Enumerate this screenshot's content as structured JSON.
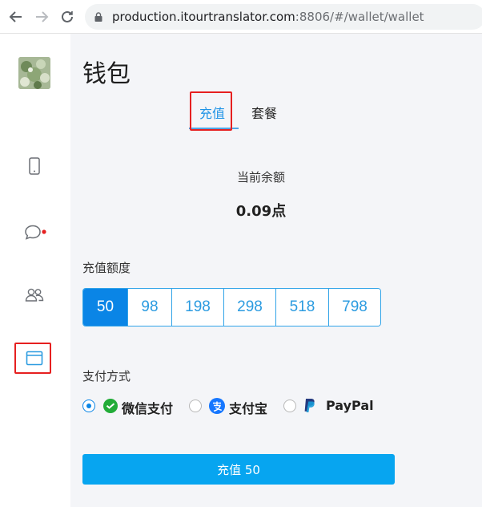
{
  "browser": {
    "url_host": "production.itourtranslator.com",
    "url_rest": ":8806/#/wallet/wallet",
    "back_icon": "arrow-left-icon",
    "forward_icon": "arrow-right-icon",
    "reload_icon": "reload-icon",
    "lock_icon": "lock-icon"
  },
  "sidebar": {
    "items": [
      {
        "name": "phone",
        "icon": "phone-icon"
      },
      {
        "name": "chat",
        "icon": "chat-icon",
        "has_badge": true
      },
      {
        "name": "contacts",
        "icon": "contacts-icon"
      },
      {
        "name": "wallet",
        "icon": "wallet-icon",
        "active": true
      }
    ],
    "accent": "#2b9be0",
    "badge_color": "#e62020"
  },
  "page": {
    "title": "钱包",
    "tabs": [
      {
        "label": "充值",
        "active": true
      },
      {
        "label": "套餐",
        "active": false
      }
    ],
    "balance_label": "当前余额",
    "balance_value": "0.09点",
    "amount_label": "充值额度",
    "amounts": [
      "50",
      "98",
      "198",
      "298",
      "518",
      "798"
    ],
    "selected_amount": "50",
    "payment_label": "支付方式",
    "payment_methods": [
      {
        "label": "微信支付",
        "icon": "wechat-pay-icon",
        "checked": true
      },
      {
        "label": "支付宝",
        "icon": "alipay-icon",
        "checked": false
      },
      {
        "label": "PayPal",
        "icon": "paypal-icon",
        "checked": false
      }
    ],
    "submit_label": "充值 50"
  },
  "colors": {
    "primary": "#0a85e6",
    "button": "#07a5f0",
    "highlight_box": "#e62020",
    "background": "#f4f5f8"
  }
}
